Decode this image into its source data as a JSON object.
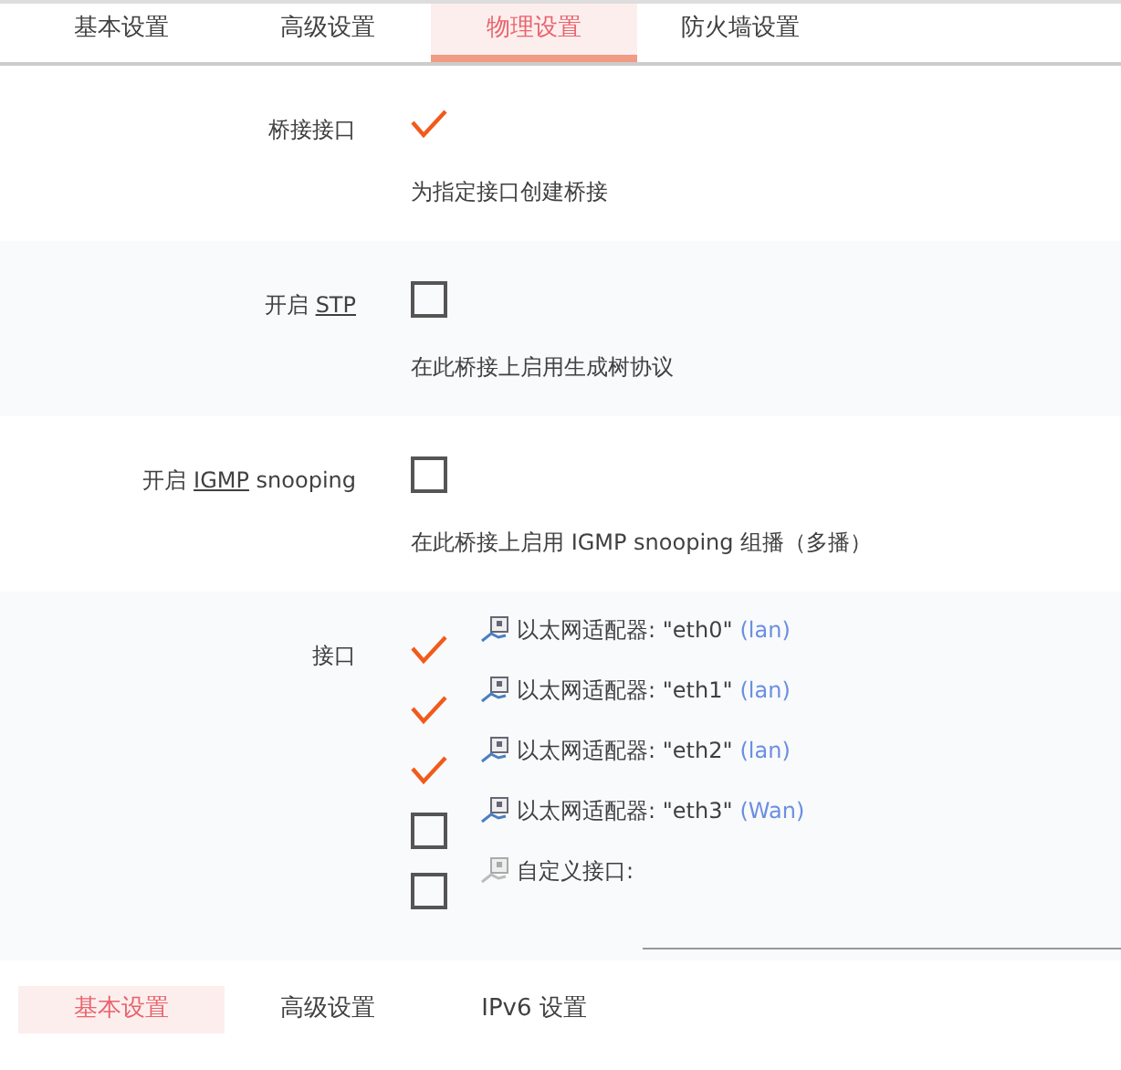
{
  "tabs": [
    {
      "label": "基本设置",
      "selected": false
    },
    {
      "label": "高级设置",
      "selected": false
    },
    {
      "label": "物理设置",
      "selected": true
    },
    {
      "label": "防火墙设置",
      "selected": false
    }
  ],
  "options": [
    {
      "label": "桥接接口",
      "checked": true,
      "description": "为指定接口创建桥接"
    },
    {
      "label": "开启",
      "abbr": "STP",
      "checked": false,
      "description": "在此桥接上启用生成树协议"
    },
    {
      "label": "开启",
      "abbr": "IGMP",
      "suffix": "snooping",
      "checked": false,
      "description": "在此桥接上启用 IGMP snooping 组播（多播）"
    }
  ],
  "interfaces": {
    "label": "接口",
    "items": [
      {
        "kind": "adapter",
        "name": "以太网适配器: \"eth0\"",
        "network": "(lan)",
        "checked": true
      },
      {
        "kind": "adapter",
        "name": "以太网适配器: \"eth1\"",
        "network": "(lan)",
        "checked": true
      },
      {
        "kind": "adapter",
        "name": "以太网适配器: \"eth2\"",
        "network": "(lan)",
        "checked": true
      },
      {
        "kind": "adapter",
        "name": "以太网适配器: \"eth3\"",
        "network": "(Wan)",
        "checked": false
      },
      {
        "kind": "custom",
        "name": "自定义接口:",
        "checked": false
      }
    ]
  },
  "bottom_tabs": [
    {
      "label": "基本设置",
      "selected": true
    },
    {
      "label": "高级设置",
      "selected": false
    },
    {
      "label": "IPv6 设置",
      "selected": false
    }
  ]
}
